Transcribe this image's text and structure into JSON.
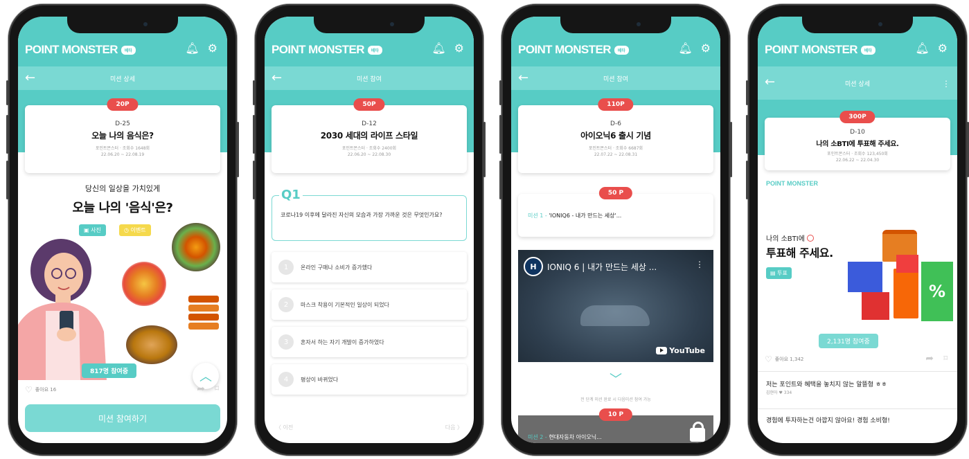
{
  "brand": {
    "name": "POINT MONSTER",
    "badge": "베타"
  },
  "phones": [
    {
      "header": "미션 상세",
      "pill": "20P",
      "dday": "D-25",
      "title": "오늘 나의 음식은?",
      "meta1": "포인트몬스터 · 조회수 1648회",
      "meta2": "22.06.20 ~ 22.08.19",
      "sub_heading": "당신의 일상을 가치있게",
      "big_heading": "오늘 나의 '음식'은?",
      "chip_photo": "사진",
      "chip_daily": "이벤트",
      "count": "817명 참여중",
      "likes": "좋아요 16",
      "cta": "미션 참여하기"
    },
    {
      "header": "미션 참여",
      "pill": "50P",
      "dday": "D-12",
      "title": "2030 세대의 라이프 스타일",
      "meta1": "포인트몬스터 · 조회수 2400회",
      "meta2": "22.06.20 ~ 22.08.30",
      "q_label": "Q1",
      "question": "코로나19 이후에 달라진 자신의 모습과 가장 가까운 것은 무엇인가요?",
      "options": [
        {
          "num": "1",
          "text": "온라인 구매나 소비가 증가했다"
        },
        {
          "num": "2",
          "text": "마스크 착용이 기본적인 일상이 되었다"
        },
        {
          "num": "3",
          "text": "혼자서 하는 자기 개발이 증가하였다"
        },
        {
          "num": "4",
          "text": "평상이 바뀌었다"
        }
      ],
      "prev": "이전",
      "next": "다음"
    },
    {
      "header": "미션 참여",
      "pill": "110P",
      "dday": "D-6",
      "title": "아이오닉6 출시 기념",
      "meta1": "포인트몬스터 · 조회수 6687회",
      "meta2": "22.07.22 ~ 22.08.31",
      "sub_pill": "50 P",
      "sub_prefix": "미션 1 - ",
      "sub_text": "'IONIQ6 - 내가 만드는 세상'...",
      "video_title": "IONIQ 6 | 내가 만드는 세상 ...",
      "video_logo": "H",
      "youtube": "YouTube",
      "hint": "전 단계 미션 완료 시 다음미션 참여 가능",
      "lock_pill": "10 P",
      "lock_prefix": "미션 2 - ",
      "lock_text": "현대자동차 아이오닉..."
    },
    {
      "header": "미션 상세",
      "pill": "300P",
      "dday": "D-10",
      "title": "나의 소BTI에 투표해 주세요.",
      "meta1": "포인트몬스터 · 조회수 123,450회",
      "meta2": "22.06.22 ~ 22.04.30",
      "pm_label": "POINT MONSTER",
      "sub": "나의 소BTI에",
      "big": "투표해 주세요.",
      "chip": "투표",
      "count": "2,131명 참여중",
      "likes": "좋아요 1,342",
      "comments": [
        {
          "text": "저는 포인트와 혜택을 놓치지 않는 알뜰형 ㅎㅎ",
          "meta": "김현아  ♥ 334"
        },
        {
          "text": "경험에 투자하는건 아깝지 않아요! 경험 소비형!",
          "meta": ""
        }
      ]
    }
  ]
}
